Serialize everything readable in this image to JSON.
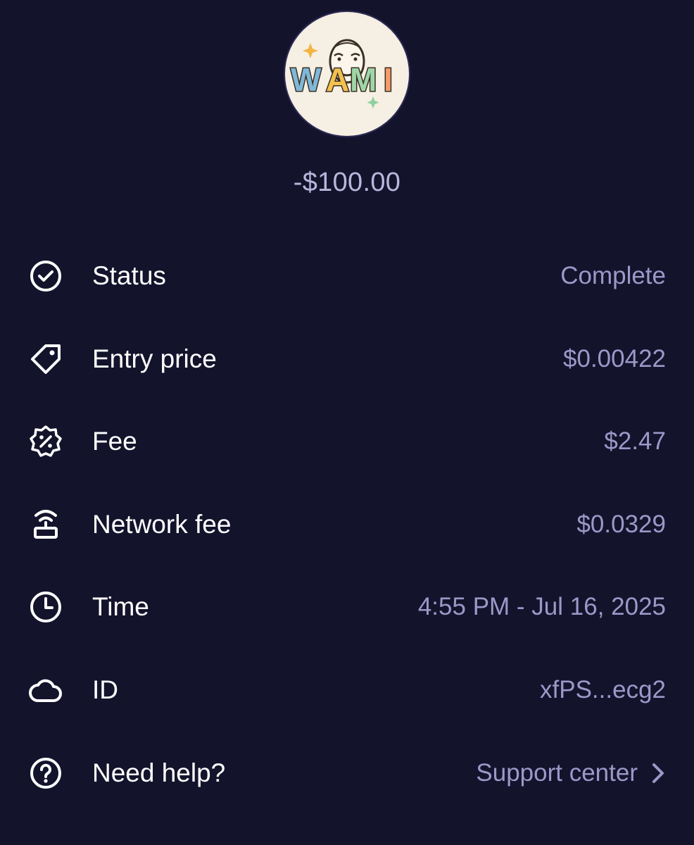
{
  "header": {
    "token_logo_text": "WAMI",
    "amount": "-$100.00"
  },
  "rows": [
    {
      "icon": "check-circle-icon",
      "label": "Status",
      "value": "Complete"
    },
    {
      "icon": "price-tag-icon",
      "label": "Entry price",
      "value": "$0.00422"
    },
    {
      "icon": "percent-badge-icon",
      "label": "Fee",
      "value": "$2.47"
    },
    {
      "icon": "router-icon",
      "label": "Network fee",
      "value": "$0.0329"
    },
    {
      "icon": "clock-icon",
      "label": "Time",
      "value": "4:55 PM - Jul 16, 2025"
    },
    {
      "icon": "cloud-icon",
      "label": "ID",
      "value": "xfPS...ecg2"
    },
    {
      "icon": "help-circle-icon",
      "label": "Need help?",
      "value": "Support center",
      "trailing_icon": "chevron-right-icon"
    }
  ],
  "colors": {
    "background": "#14132c",
    "label": "#ffffff",
    "value": "#9c98c8",
    "amount": "#b9b6dc"
  }
}
